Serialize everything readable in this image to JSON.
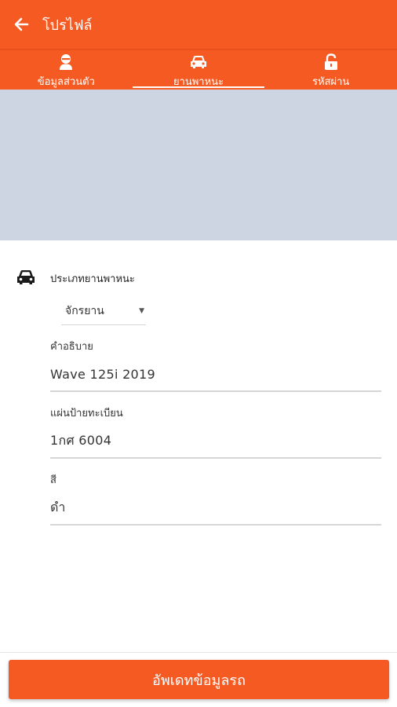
{
  "appbar": {
    "title": "โปรไฟล์",
    "back_icon": "arrow-left-icon"
  },
  "tabs": [
    {
      "label": "ข้อมูลส่วนตัว",
      "icon": "user-icon",
      "active": false
    },
    {
      "label": "ยานพาหนะ",
      "icon": "car-icon",
      "active": true
    },
    {
      "label": "รหัสผ่าน",
      "icon": "unlock-icon",
      "active": false
    }
  ],
  "vehicle": {
    "type_label": "ประเภทยานพาหนะ",
    "type_value": "จักรยาน",
    "description_label": "คำอธิบาย",
    "description_value": "Wave 125i 2019",
    "plate_label": "แผ่นป้ายทะเบียน",
    "plate_value": "1กศ 6004",
    "color_label": "สี",
    "color_value": "ดำ"
  },
  "submit_label": "อัพเดทข้อมูลรถ",
  "colors": {
    "accent": "#f45a22",
    "map_bg": "#ccd5e1"
  }
}
